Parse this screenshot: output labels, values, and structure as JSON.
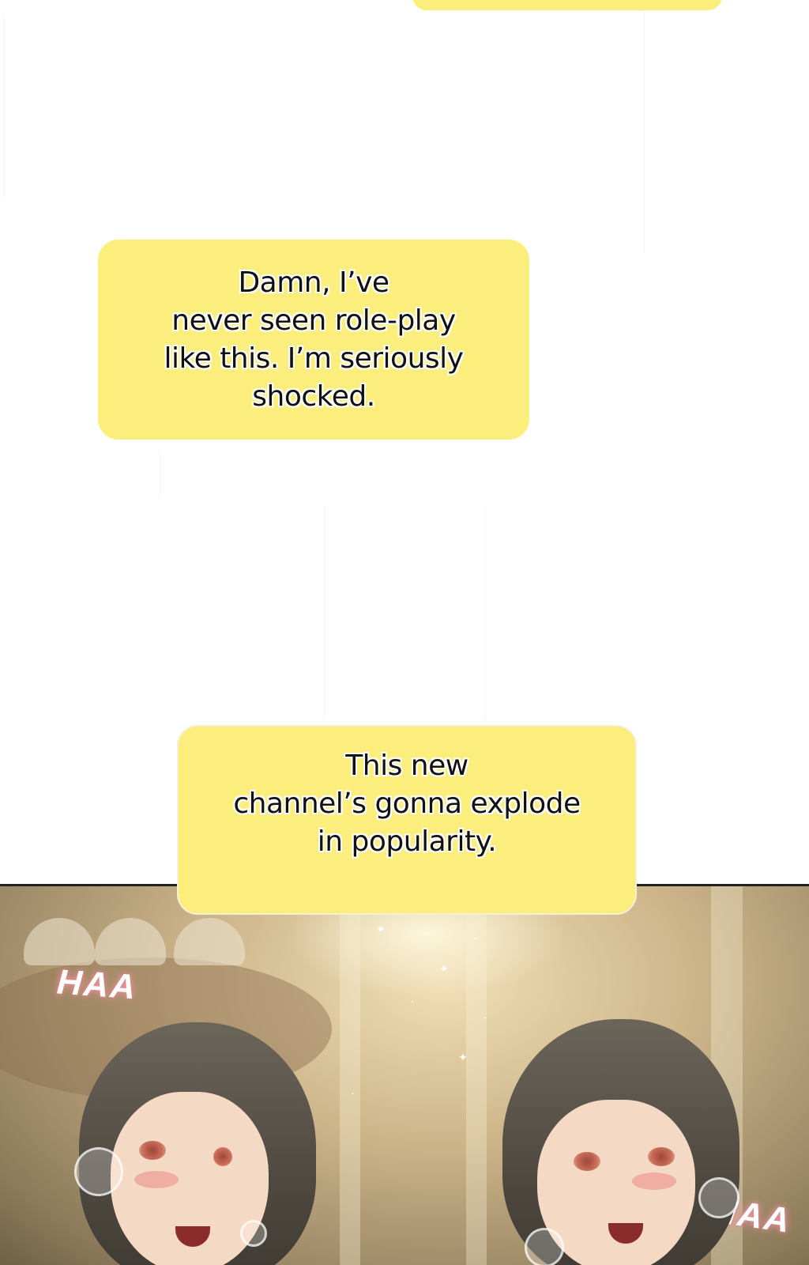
{
  "bubbles": {
    "bubble_1": "Damn, I’ve\nnever seen role-play\nlike this. I’m seriously\nshocked.",
    "bubble_2": "This new\nchannel’s gonna explode\nin popularity."
  },
  "sound_effects": {
    "left": "HAA",
    "right": "HAA"
  },
  "colors": {
    "bubble_fill": "#fbee7c",
    "text": "#111111",
    "sfx_glow": "#f29aa5"
  }
}
